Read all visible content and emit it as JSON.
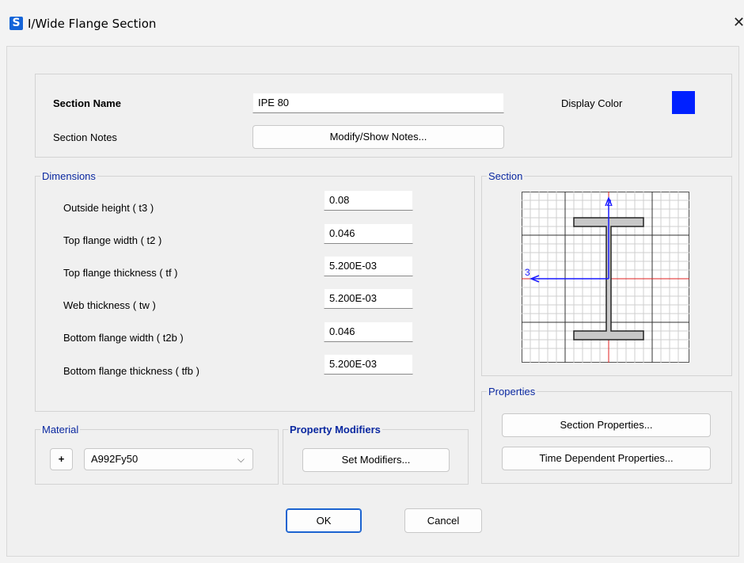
{
  "window": {
    "title": "I/Wide Flange Section",
    "app_icon": "S"
  },
  "section": {
    "name_label": "Section Name",
    "name_value": "IPE 80",
    "notes_label": "Section Notes",
    "notes_button": "Modify/Show Notes...",
    "display_color_label": "Display Color",
    "display_color": "#0020ff"
  },
  "dimensions": {
    "legend": "Dimensions",
    "rows": [
      {
        "label": "Outside height  ( t3 )",
        "value": "0.08"
      },
      {
        "label": "Top flange width  ( t2 )",
        "value": "0.046"
      },
      {
        "label": "Top flange thickness  ( tf )",
        "value": "5.200E-03"
      },
      {
        "label": "Web thickness  ( tw )",
        "value": "5.200E-03"
      },
      {
        "label": "Bottom flange width  ( t2b )",
        "value": "0.046"
      },
      {
        "label": "Bottom flange thickness  ( tfb )",
        "value": "5.200E-03"
      }
    ]
  },
  "section_preview": {
    "legend": "Section",
    "axis2": "2",
    "axis3": "3"
  },
  "properties": {
    "legend": "Properties",
    "section_properties_button": "Section Properties...",
    "time_dependent_button": "Time Dependent Properties..."
  },
  "material": {
    "legend": "Material",
    "add_button": "+",
    "selected": "A992Fy50"
  },
  "modifiers": {
    "legend": "Property Modifiers",
    "button": "Set Modifiers..."
  },
  "footer": {
    "ok": "OK",
    "cancel": "Cancel"
  },
  "colors": {
    "legend": "#0a28a0",
    "accent": "#1b63d0",
    "axis_blue": "#1a1aff",
    "axis_red": "#e02020"
  }
}
